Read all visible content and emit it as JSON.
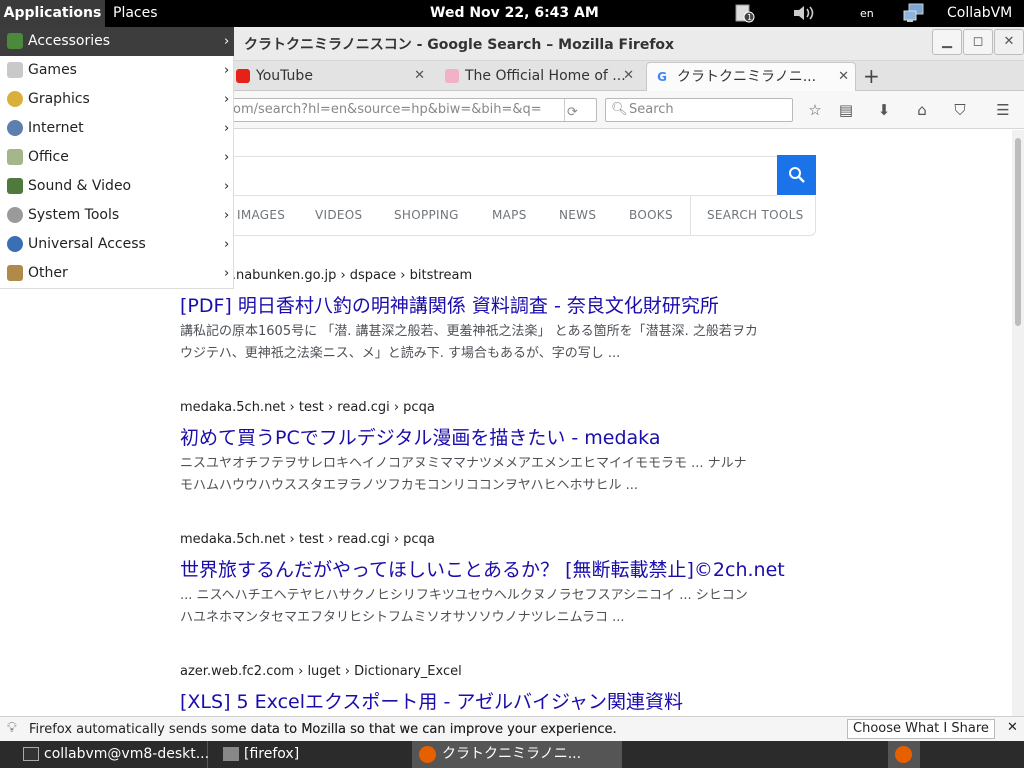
{
  "topbar": {
    "applications": "Applications",
    "places": "Places",
    "clock": "Wed Nov 22,  6:43 AM",
    "lang": "en",
    "user": "CollabVM"
  },
  "app_menu": {
    "items": [
      {
        "label": "Accessories",
        "icon": "accessories-icon",
        "selected": true
      },
      {
        "label": "Games",
        "icon": "games-icon"
      },
      {
        "label": "Graphics",
        "icon": "graphics-icon"
      },
      {
        "label": "Internet",
        "icon": "internet-icon"
      },
      {
        "label": "Office",
        "icon": "office-icon"
      },
      {
        "label": "Sound & Video",
        "icon": "sound-video-icon"
      },
      {
        "label": "System Tools",
        "icon": "system-tools-icon"
      },
      {
        "label": "Universal Access",
        "icon": "universal-access-icon"
      },
      {
        "label": "Other",
        "icon": "other-icon"
      }
    ]
  },
  "window": {
    "title": "クラトクニミラノニスコン  -  Google Search – Mozilla Firefox"
  },
  "tabs": [
    {
      "label": "YouTube"
    },
    {
      "label": "The Official Home of ..."
    },
    {
      "label": "クラトクニミラノニ..."
    }
  ],
  "navbar": {
    "url": "om/search?hl=en&source=hp&biw=&bih=&q=",
    "search_placeholder": "Search"
  },
  "google": {
    "tabs": [
      "IMAGES",
      "VIDEOS",
      "SHOPPING",
      "MAPS",
      "NEWS",
      "BOOKS",
      "SEARCH TOOLS"
    ]
  },
  "results": [
    {
      "cite": "y.nabunken.go.jp › dspace › bitstream",
      "title": "[PDF] 明日香村八釣の明神講関係 資料調査 - 奈良文化財研究所",
      "snippet1": "講私記の原本1605号に 「潜. 講甚深之般若、更羞神祇之法楽」 とある箇所を「潜甚深. 之般若ヲカ",
      "snippet2": "ウジテハ、更神祇之法楽ニス、メ」と読み下. す場合もあるが、字の写し ..."
    },
    {
      "cite": "medaka.5ch.net › test › read.cgi › pcqa",
      "title": "初めて買うPCでフルデジタル漫画を描きたい - medaka",
      "snippet1": "ニスユヤオチフテヲサレロキヘイノコアヌミママナツメメアエメンエヒマイイモモラモ ... ナルナ",
      "snippet2": "モハムハウウハウススタエヲラノツフカモコンリココンヲヤハヒヘホサヒル ..."
    },
    {
      "cite": "medaka.5ch.net › test › read.cgi › pcqa",
      "title": "世界旅するんだがやってほしいことあるか？ [無断転載禁止]©2ch.net",
      "snippet1": "... ニスヘハチエヘテヤヒハサクノヒシリフキツユセウヘルクヌノラセフスアシニコイ ... シヒコン",
      "snippet2": "ハユネホマンタセマエフタリヒシトフムミソオサソソウノナツレニムラコ ..."
    },
    {
      "cite": "azer.web.fc2.com › luget › Dictionary_Excel",
      "title": "[XLS] 5 Excelエクスポート用 - アゼルバイジャン関連資料",
      "snippet1": "",
      "snippet2": ""
    }
  ],
  "notification": {
    "text": "Firefox automatically sends some data to Mozilla so that we can improve your experience.",
    "button": "Choose What I Share"
  },
  "taskbar": {
    "items": [
      {
        "label": "collabvm@vm8-deskt..."
      },
      {
        "label": "[firefox]"
      },
      {
        "label": "クラトクニミラノニ..."
      }
    ]
  }
}
